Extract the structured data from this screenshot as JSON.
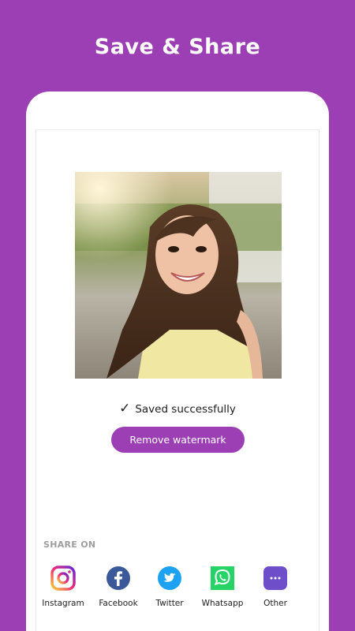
{
  "headline": "Save & Share",
  "status": {
    "check_glyph": "✓",
    "message": "Saved successfully"
  },
  "watermark_button": {
    "label": "Remove watermark"
  },
  "share": {
    "heading": "SHARE ON",
    "items": [
      {
        "label": "Instagram",
        "icon": "instagram-icon"
      },
      {
        "label": "Facebook",
        "icon": "facebook-icon"
      },
      {
        "label": "Twitter",
        "icon": "twitter-icon"
      },
      {
        "label": "Whatsapp",
        "icon": "whatsapp-icon"
      },
      {
        "label": "Other",
        "icon": "more-icon"
      }
    ]
  },
  "colors": {
    "background": "#9c3fb5",
    "button": "#9c3fb5",
    "facebook": "#3b5998",
    "twitter": "#1da1f2",
    "whatsapp": "#25d366",
    "other": "#6f4fc9"
  }
}
